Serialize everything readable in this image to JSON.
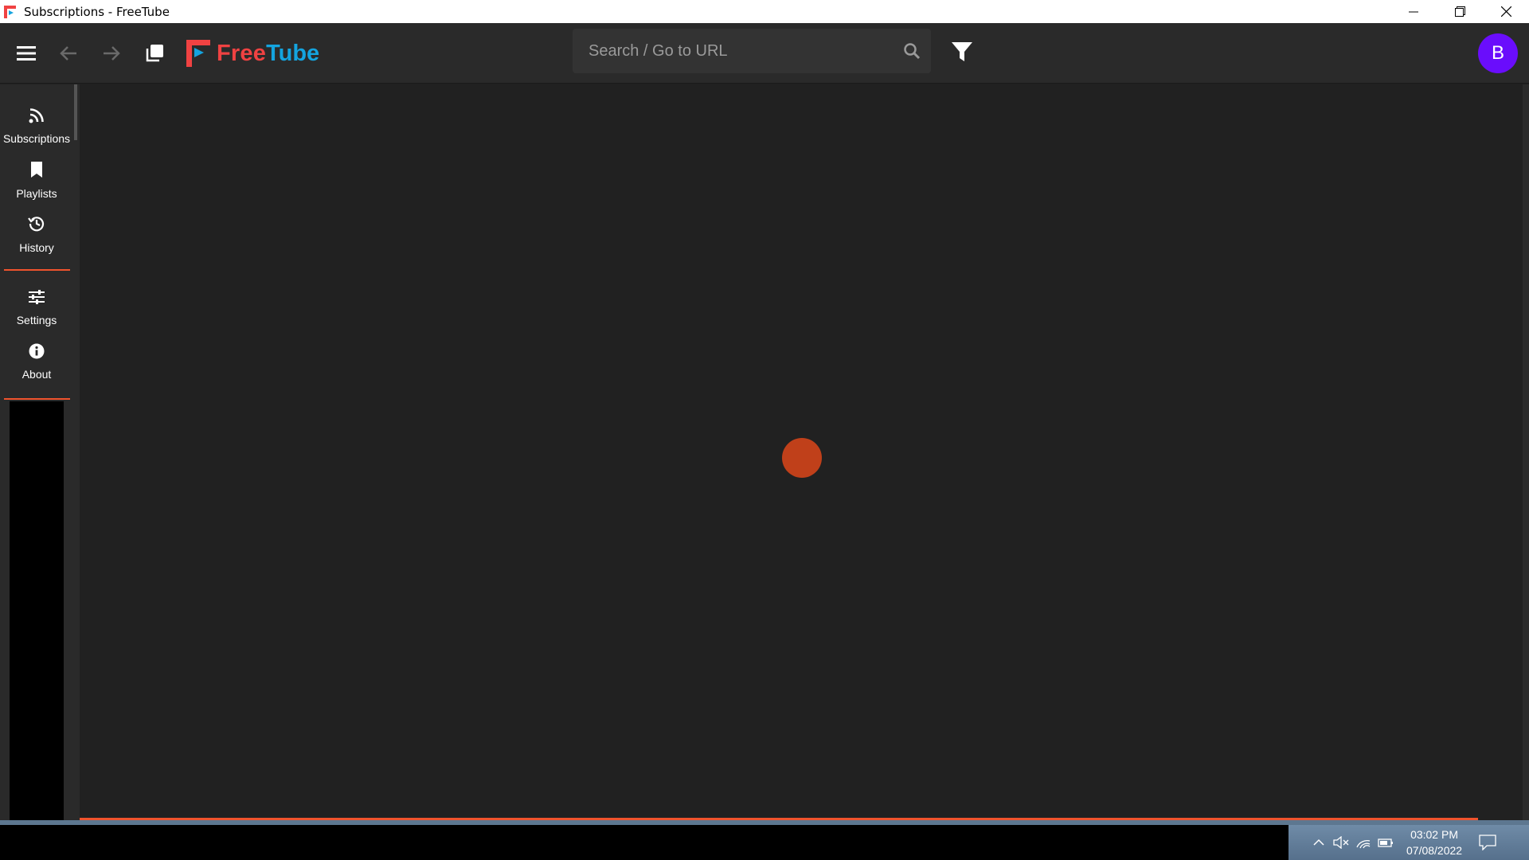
{
  "window": {
    "title": "Subscriptions - FreeTube"
  },
  "header": {
    "logo_free": "Free",
    "logo_tube": "Tube",
    "search_placeholder": "Search / Go to URL",
    "avatar_initial": "B"
  },
  "sidenav": {
    "items": [
      {
        "label": "Subscriptions",
        "icon": "rss-icon"
      },
      {
        "label": "Playlists",
        "icon": "bookmark-icon"
      },
      {
        "label": "History",
        "icon": "history-icon"
      }
    ],
    "secondary": [
      {
        "label": "Settings",
        "icon": "sliders-icon"
      },
      {
        "label": "About",
        "icon": "info-icon"
      }
    ]
  },
  "taskbar": {
    "time": "03:02 PM",
    "date": "07/08/2022"
  },
  "colors": {
    "accent": "#f0532d",
    "logo_red": "#f04242",
    "logo_blue": "#14a4df",
    "avatar": "#6a0dfc",
    "loader": "#c0401a"
  }
}
